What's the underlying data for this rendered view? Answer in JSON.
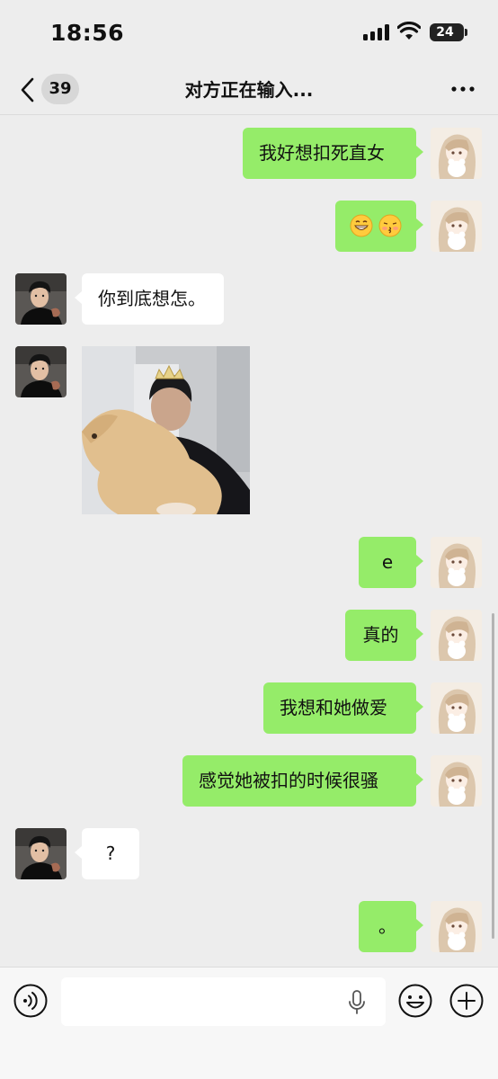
{
  "status_bar": {
    "time": "18:56",
    "battery": "24"
  },
  "nav": {
    "unread_count": "39",
    "title": "对方正在输入..."
  },
  "messages": [
    {
      "side": "self",
      "type": "text",
      "text": "我好想扣死直女"
    },
    {
      "side": "self",
      "type": "emoji",
      "emojis": [
        "grinning-face-icon",
        "kissing-face-icon"
      ]
    },
    {
      "side": "other",
      "type": "text",
      "text": "你到底想怎。"
    },
    {
      "side": "other",
      "type": "image",
      "image": "photo-man-holding-dog-with-crown"
    },
    {
      "side": "self",
      "type": "text",
      "text": "e"
    },
    {
      "side": "self",
      "type": "text",
      "text": "真的"
    },
    {
      "side": "self",
      "type": "text",
      "text": "我想和她做爱"
    },
    {
      "side": "self",
      "type": "text",
      "text": "感觉她被扣的时候很骚"
    },
    {
      "side": "other",
      "type": "text",
      "text": "?"
    },
    {
      "side": "self",
      "type": "text",
      "text": "。"
    }
  ],
  "input_bar": {
    "placeholder": "",
    "value": ""
  },
  "colors": {
    "self_bubble": "#95ec69",
    "other_bubble": "#ffffff",
    "background": "#ededed"
  }
}
